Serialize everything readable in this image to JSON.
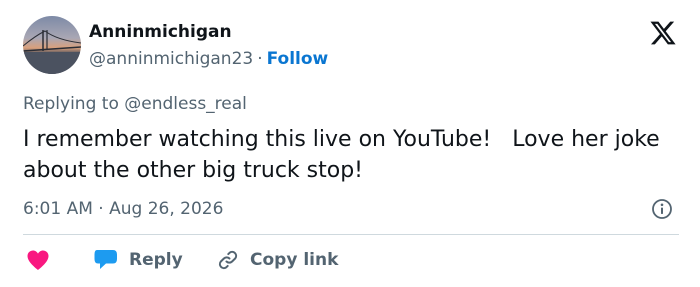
{
  "author": {
    "display_name": "Anninmichigan",
    "handle": "@anninmichigan23",
    "separator": "·",
    "follow_label": "Follow"
  },
  "reply_context": {
    "prefix": "Replying to",
    "mention": "@endless_real"
  },
  "tweet": {
    "text": "I remember watching this live on YouTube!   Love her joke about the other big truck stop!",
    "time": "6:01 AM",
    "separator": "·",
    "date": "Aug 26, 2026"
  },
  "actions": {
    "reply_label": "Reply",
    "copy_link_label": "Copy link"
  },
  "icons": {
    "logo": "x-logo-icon",
    "info": "info-icon",
    "like": "heart-icon",
    "reply": "speech-bubble-icon",
    "copy": "link-icon"
  },
  "colors": {
    "text": "#0f1419",
    "secondary": "#536471",
    "link": "#0a76d1",
    "heart": "#f91880",
    "reply_bubble": "#1d9bf0",
    "divider": "#cfd9de"
  }
}
